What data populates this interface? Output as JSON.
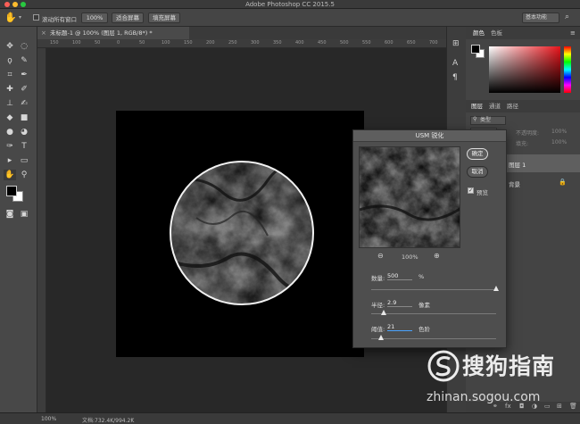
{
  "app": {
    "title": "Adobe Photoshop CC 2015.5",
    "workspace": "基本功能"
  },
  "options_bar": {
    "scroll_all_label": "滚动所有窗口",
    "zoom_100": "100%",
    "fit_screen": "适合屏幕",
    "fill_screen": "填充屏幕"
  },
  "document": {
    "tab_title": "未标题-1 @ 100% (图层 1, RGB/8*) *",
    "ruler_ticks": [
      "150",
      "100",
      "50",
      "0",
      "50",
      "100",
      "150",
      "200",
      "250",
      "300",
      "350",
      "400",
      "450",
      "500",
      "550",
      "600",
      "650",
      "700"
    ]
  },
  "status": {
    "zoom": "100%",
    "doc_info": "文档:732.4K/994.2K"
  },
  "panels": {
    "color_tab": "颜色",
    "swatches_tab": "色板",
    "layers_tab": "图层",
    "channels_tab": "通道",
    "paths_tab": "路径",
    "kind_filter": "类型",
    "opacity_label": "不透明度:",
    "opacity_value": "100%",
    "fill_label": "填充:",
    "fill_value": "100%",
    "layer1_name": "图层 1",
    "background_name": "背景"
  },
  "dialog": {
    "title": "USM 锐化",
    "ok": "确定",
    "cancel": "取消",
    "preview_label": "预览",
    "preview_checked": true,
    "zoom": "100%",
    "amount_label": "数量:",
    "amount_value": "500",
    "amount_unit": "%",
    "amount_fraction": 1.0,
    "radius_label": "半径:",
    "radius_value": "2.9",
    "radius_unit": "像素",
    "radius_fraction": 0.1,
    "threshold_label": "阈值:",
    "threshold_value": "21",
    "threshold_unit": "色阶",
    "threshold_fraction": 0.08
  },
  "watermark": {
    "brand": "搜狗指南",
    "url": "zhinan.sogou.com"
  },
  "colors": {
    "foreground": "#000000",
    "background": "#ffffff"
  }
}
